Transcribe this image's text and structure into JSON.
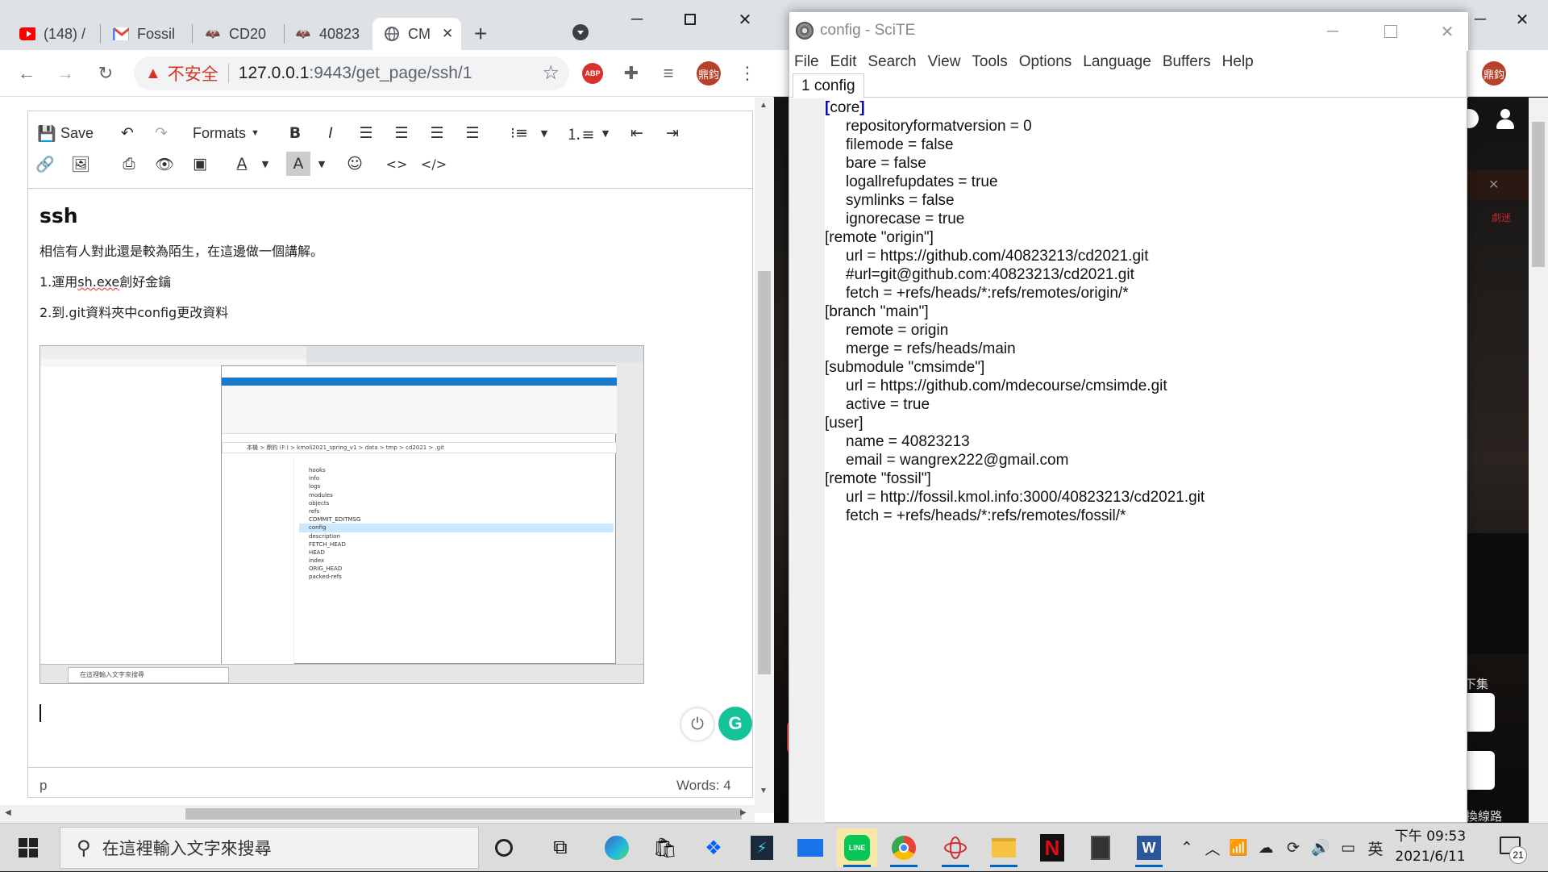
{
  "chrome": {
    "tabs": [
      {
        "label": "(148) /",
        "icon": "youtube-icon"
      },
      {
        "label": "Fossil",
        "icon": "gmail-icon"
      },
      {
        "label": "CD20",
        "icon": "fossil-icon"
      },
      {
        "label": "40823",
        "icon": "fossil-icon"
      },
      {
        "label": "CM",
        "icon": "globe-icon"
      }
    ],
    "new_tab": "+",
    "insecure_label": "不安全",
    "url_host": "127.0.0.1",
    "url_path": ":9443/get_page/ssh/1",
    "profile_initials": "鼎鈞",
    "abp_label": "ABP"
  },
  "editor": {
    "toolbar": {
      "save_label": "Save",
      "formats_label": "Formats"
    },
    "heading": "ssh",
    "paragraphs": {
      "p1": "相信有人對此還是較為陌生，在這邊做一個講解。",
      "p2_prefix": "1.運用",
      "p2_link": "sh.exe",
      "p2_suffix": "創好金鑰",
      "p3": "2.到.git資料夾中config更改資料"
    },
    "status_left": "p",
    "status_right": "Words: 4"
  },
  "thumbnail": {
    "rows": [
      "hooks",
      "info",
      "logs",
      "modules",
      "objects",
      "refs",
      "COMMIT_EDITMSG",
      "config",
      "description",
      "FETCH_HEAD",
      "HEAD",
      "index",
      "ORIG_HEAD",
      "packed-refs"
    ],
    "selected_row": "config",
    "search_text": "在這裡輸入文字來搜尋",
    "path": "本機 > 鼎鈞 (F:) > kmoli2021_spring_v1 > data > tmp > cd2021 > .git"
  },
  "scite": {
    "title": "config - SciTE",
    "menu": [
      "File",
      "Edit",
      "Search",
      "View",
      "Tools",
      "Options",
      "Language",
      "Buffers",
      "Help"
    ],
    "tab_label": "1 config",
    "lines": [
      {
        "type": "sec",
        "text": "[core]"
      },
      {
        "type": "kv",
        "text": "repositoryformatversion = 0"
      },
      {
        "type": "kv",
        "text": "filemode = false"
      },
      {
        "type": "kv",
        "text": "bare = false"
      },
      {
        "type": "kv",
        "text": "logallrefupdates = true"
      },
      {
        "type": "kv",
        "text": "symlinks = false"
      },
      {
        "type": "kv",
        "text": "ignorecase = true"
      },
      {
        "type": "sec",
        "text": "[remote \"origin\"]"
      },
      {
        "type": "kv",
        "text": "url = https://github.com/40823213/cd2021.git"
      },
      {
        "type": "kv",
        "text": "#url=git@github.com:40823213/cd2021.git"
      },
      {
        "type": "kv",
        "text": "fetch = +refs/heads/*:refs/remotes/origin/*"
      },
      {
        "type": "sec",
        "text": "[branch \"main\"]"
      },
      {
        "type": "kv",
        "text": "remote = origin"
      },
      {
        "type": "kv",
        "text": "merge = refs/heads/main"
      },
      {
        "type": "sec",
        "text": "[submodule \"cmsimde\"]"
      },
      {
        "type": "kv",
        "text": "url = https://github.com/mdecourse/cmsimde.git"
      },
      {
        "type": "kv",
        "text": "active = true"
      },
      {
        "type": "sec",
        "text": "[user]"
      },
      {
        "type": "kv",
        "text": "name = 40823213"
      },
      {
        "type": "kv",
        "text": "email = wangrex222@gmail.com"
      },
      {
        "type": "sec",
        "text": "[remote \"fossil\"]"
      },
      {
        "type": "kv",
        "text": "url = http://fossil.kmol.info:3000/40823213/cd2021.git"
      },
      {
        "type": "kv",
        "text": "fetch = +refs/heads/*:refs/remotes/fossil/*"
      }
    ]
  },
  "bg_browser": {
    "text_next": "下集",
    "text_route": "換線路",
    "text_side": "劇迷"
  },
  "taskbar": {
    "search_placeholder": "在這裡輸入文字來搜尋",
    "ime": "英",
    "time": "下午 09:53",
    "date": "2021/6/11",
    "notification_count": "21"
  },
  "colors": {
    "accent": "#0067c0",
    "insecure": "#d93025",
    "scite_section": "#0000c0",
    "grammarly": "#15c39a"
  }
}
